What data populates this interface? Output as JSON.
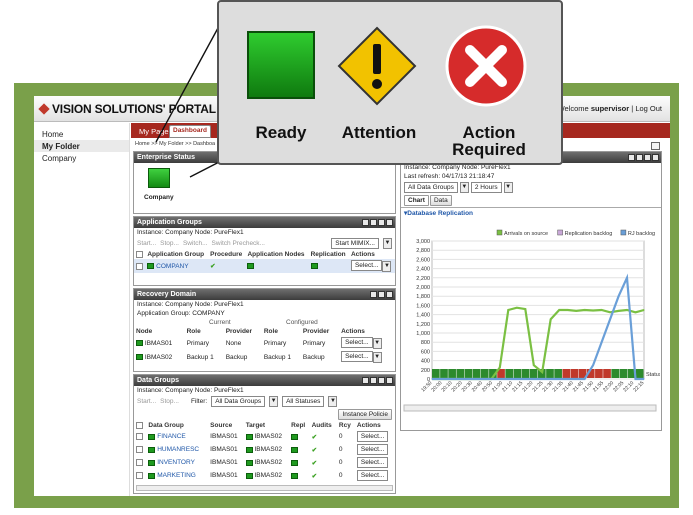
{
  "brand": {
    "name": "VISION SOLUTIONS' PORTAL"
  },
  "header": {
    "welcome_prefix": "Welcome",
    "user": "supervisor",
    "separator": "|",
    "logout": "Log Out"
  },
  "nav": {
    "items": [
      "Home",
      "My Folder",
      "Company"
    ]
  },
  "tabs": [
    "My Page",
    "Dashboard"
  ],
  "breadcrumb": "Home >> My Folder >> Dashboa",
  "enterprise": {
    "title": "Enterprise Status",
    "node_label": "Company"
  },
  "legend": {
    "ready": "Ready",
    "attention": "Attention",
    "action_line1": "Action",
    "action_line2": "Required"
  },
  "app_groups": {
    "title": "Application Groups",
    "instance_line": "Instance: Company   Node: PureFlex1",
    "buttons": [
      "Start...",
      "Stop...",
      "Switch...",
      "Switch Precheck..."
    ],
    "start_mimix": "Start MIMIX...",
    "headers": [
      "Application Group",
      "Procedure",
      "Application Nodes",
      "Replication",
      "Actions"
    ],
    "rows": [
      {
        "name": "COMPANY",
        "action": "Select..."
      }
    ]
  },
  "recovery": {
    "title": "Recovery Domain",
    "instance_line": "Instance: Company   Node: PureFlex1",
    "app_group_line": "Application Group:  COMPANY",
    "group_current": "Current",
    "group_configured": "Configured",
    "headers": [
      "Node",
      "Role",
      "Provider",
      "Role",
      "Provider",
      "Actions"
    ],
    "rows": [
      {
        "node": "IBMAS01",
        "role": "Primary",
        "provider": "None",
        "crole": "Primary",
        "cprovider": "Primary",
        "action": "Select..."
      },
      {
        "node": "IBMAS02",
        "role": "Backup 1",
        "provider": "Backup",
        "crole": "Backup 1",
        "cprovider": "Backup",
        "action": "Select..."
      }
    ]
  },
  "data_groups": {
    "title": "Data Groups",
    "instance_line": "Instance: Company   Node: PureFlex1",
    "start": "Start...",
    "stop": "Stop...",
    "filter_label": "Filter:",
    "filter_value": "All Data Groups",
    "status_value": "All Statuses",
    "instance_policies": "Instance Policie",
    "headers": [
      "Data Group",
      "Source",
      "Target",
      "Repl",
      "Audits",
      "Rcy",
      "Actions"
    ],
    "rows": [
      {
        "name": "FINANCE",
        "source": "IBMAS01",
        "target": "IBMAS02",
        "rcy": "0",
        "action": "Select..."
      },
      {
        "name": "HUMANRESC",
        "source": "IBMAS01",
        "target": "IBMAS02",
        "rcy": "0",
        "action": "Select..."
      },
      {
        "name": "INVENTORY",
        "source": "IBMAS01",
        "target": "IBMAS02",
        "rcy": "0",
        "action": "Select..."
      },
      {
        "name": "MARKETING",
        "source": "IBMAS01",
        "target": "IBMAS02",
        "rcy": "0",
        "action": "Select..."
      }
    ]
  },
  "right_panel": {
    "instance_line": "Instance: Company   Node: PureFlex1",
    "refresh_line": "Last refresh: 04/17/13 21:18:47",
    "dg_filter": "All Data Groups",
    "range": "2 Hours",
    "tabs": [
      "Chart",
      "Data"
    ],
    "section": "Database Replication"
  },
  "chart_data": {
    "type": "line",
    "title": "Database Replication",
    "series": [
      {
        "name": "Arrivals on source",
        "color": "#7bc043",
        "values": [
          0,
          0,
          0,
          0,
          0,
          0,
          0,
          0,
          250,
          1500,
          1550,
          1520,
          300,
          150,
          1300,
          1500,
          1500,
          1480,
          1500,
          1490,
          1500,
          1450,
          1480,
          1500,
          1450,
          1500
        ]
      },
      {
        "name": "Replication backlog",
        "color": "#c9a8d8",
        "values": []
      },
      {
        "name": "RJ backlog",
        "color": "#6a9fd8",
        "values": [
          0,
          0,
          0,
          0,
          0,
          0,
          0,
          0,
          0,
          0,
          0,
          0,
          0,
          0,
          0,
          0,
          0,
          0,
          0,
          300,
          800,
          1300,
          1800,
          2200,
          0,
          0
        ]
      }
    ],
    "x": [
      "19:50",
      "20:00",
      "20:10",
      "20:20",
      "20:30",
      "20:40",
      "20:50",
      "21:00",
      "21:10",
      "21:15",
      "21:20",
      "21:25",
      "21:30",
      "21:35",
      "21:40",
      "21:45",
      "21:50",
      "21:55",
      "22:00",
      "22:05",
      "22:10",
      "22:15"
    ],
    "yticks": [
      "3,000",
      "2,800",
      "2,600",
      "2,400",
      "2,200",
      "2,000",
      "1,800",
      "1,600",
      "1,400",
      "1,200",
      "1,000",
      "800",
      "600",
      "400",
      "200",
      "0"
    ],
    "ylim": [
      0,
      3000
    ],
    "status_label": "Status",
    "status_colors": [
      "#2d8a2d",
      "#2d8a2d",
      "#2d8a2d",
      "#2d8a2d",
      "#2d8a2d",
      "#2d8a2d",
      "#2d8a2d",
      "#2d8a2d",
      "#c0392b",
      "#2d8a2d",
      "#2d8a2d",
      "#2d8a2d",
      "#2d8a2d",
      "#2d8a2d",
      "#2d8a2d",
      "#2d8a2d",
      "#c0392b",
      "#c0392b",
      "#c0392b",
      "#c0392b",
      "#c0392b",
      "#c0392b",
      "#2d8a2d",
      "#2d8a2d",
      "#2d8a2d",
      "#2d8a2d"
    ],
    "grid": true,
    "legend_position": "top-right"
  },
  "colors": {
    "ready": "#1f9a1f",
    "attention": "#f2c200",
    "action_required": "#d62b2b",
    "tab_bar": "#a6281f",
    "frame": "#7aa04a"
  }
}
